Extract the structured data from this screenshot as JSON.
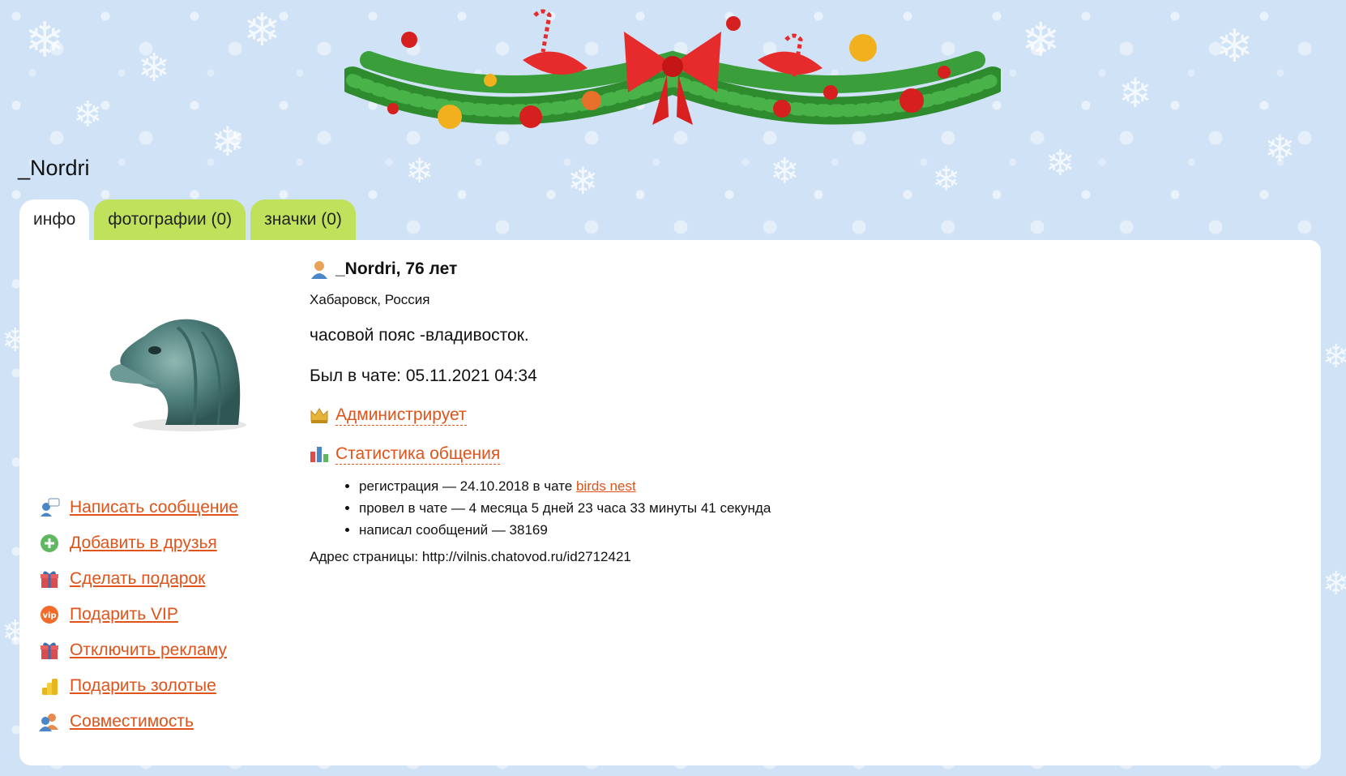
{
  "user": {
    "title": "_Nordri",
    "name_age": "_Nordri, 76 лет",
    "location": "Хабаровск, Россия",
    "status": "часовой пояс -владивосток.",
    "last_seen": "Был в чате: 05.11.2021 04:34"
  },
  "tabs": [
    {
      "label": "инфо",
      "active": true
    },
    {
      "label": "фотографии (0)",
      "active": false
    },
    {
      "label": "значки (0)",
      "active": false
    }
  ],
  "actions": [
    {
      "label": "Написать сообщение",
      "icon": "message-icon"
    },
    {
      "label": "Добавить в друзья",
      "icon": "add-friend-icon"
    },
    {
      "label": "Сделать подарок",
      "icon": "gift-icon"
    },
    {
      "label": "Подарить VIP",
      "icon": "vip-icon"
    },
    {
      "label": "Отключить рекламу",
      "icon": "gift-icon"
    },
    {
      "label": "Подарить золотые",
      "icon": "coins-icon"
    },
    {
      "label": "Совместимость",
      "icon": "users-icon"
    }
  ],
  "links": {
    "admin": "Администрирует",
    "stats": "Статистика общения"
  },
  "stats": {
    "registration_prefix": "регистрация — 24.10.2018 в чате ",
    "registration_chat": "birds nest",
    "time_in_chat": "провел в чате — 4 месяца 5 дней 23 часа 33 минуты 41 секунда",
    "messages": "написал сообщений — 38169"
  },
  "page_address": "Адрес страницы: http://vilnis.chatovod.ru/id2712421",
  "colors": {
    "link": "#e0531a",
    "tab_inactive": "#bfe15b",
    "background": "#cfe2f6"
  }
}
